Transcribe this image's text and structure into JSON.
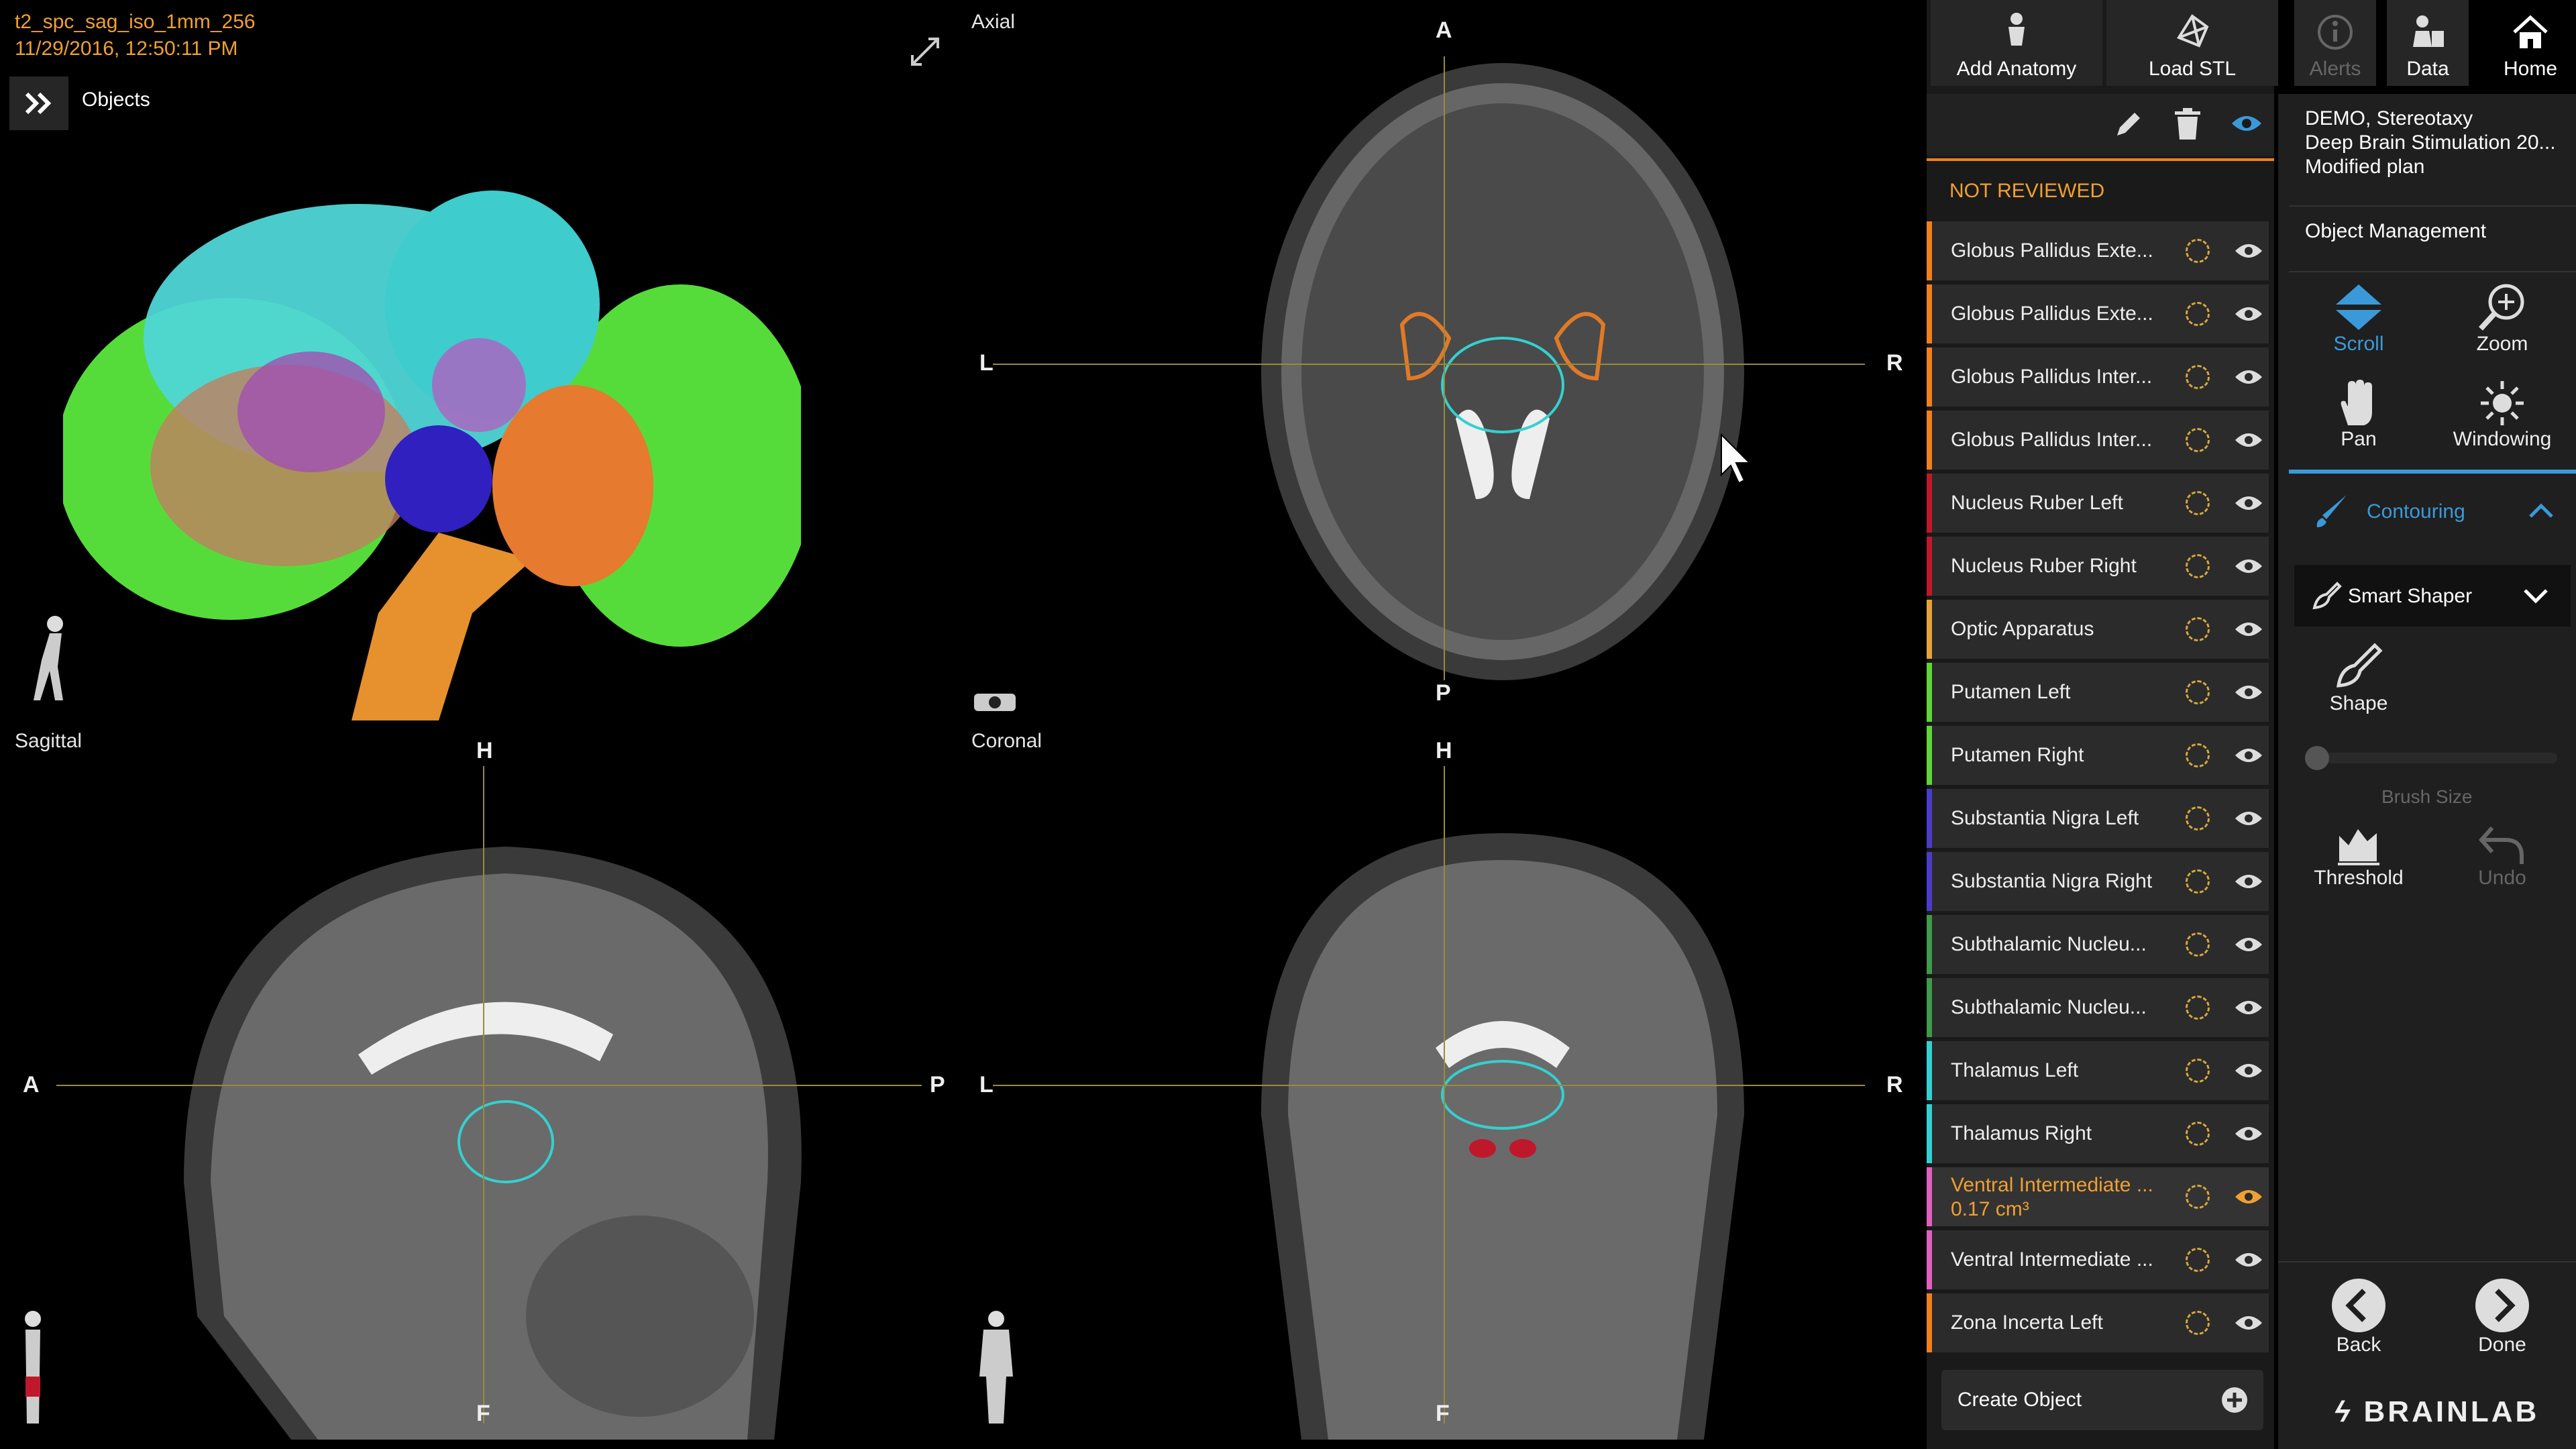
{
  "scan": {
    "series": "t2_spc_sag_iso_1mm_256",
    "datetime": "11/29/2016, 12:50:11 PM"
  },
  "view3d": {
    "objects_label": "Objects"
  },
  "views": {
    "axial": {
      "label": "Axial",
      "top": "A",
      "bottom": "P",
      "left": "L",
      "right": "R"
    },
    "sagittal": {
      "label": "Sagittal",
      "top": "H",
      "bottom": "F",
      "left": "A",
      "right": "P"
    },
    "coronal": {
      "label": "Coronal",
      "top": "H",
      "bottom": "F",
      "left": "L",
      "right": "R"
    }
  },
  "toolbar": {
    "add_anatomy": "Add Anatomy",
    "load_stl": "Load STL",
    "alerts": "Alerts",
    "data": "Data",
    "home": "Home"
  },
  "patient": {
    "name": "DEMO, Stereotaxy",
    "procedure": "Deep Brain Stimulation 20...",
    "plan": "Modified plan"
  },
  "object_management": "Object Management",
  "section_header": "NOT REVIEWED",
  "objects": [
    {
      "label": "Globus Pallidus Exte...",
      "color": "#f07f1e"
    },
    {
      "label": "Globus Pallidus Exte...",
      "color": "#f07f1e"
    },
    {
      "label": "Globus Pallidus Inter...",
      "color": "#f07f1e"
    },
    {
      "label": "Globus Pallidus Inter...",
      "color": "#f07f1e"
    },
    {
      "label": "Nucleus Ruber Left",
      "color": "#c0182b"
    },
    {
      "label": "Nucleus Ruber Right",
      "color": "#c0182b"
    },
    {
      "label": "Optic Apparatus",
      "color": "#e6a23a"
    },
    {
      "label": "Putamen Left",
      "color": "#5dd63a"
    },
    {
      "label": "Putamen Right",
      "color": "#5dd63a"
    },
    {
      "label": "Substantia Nigra Left",
      "color": "#4b3cc8"
    },
    {
      "label": "Substantia Nigra Right",
      "color": "#4b3cc8"
    },
    {
      "label": "Subthalamic Nucleu...",
      "color": "#3f9a4a"
    },
    {
      "label": "Subthalamic Nucleu...",
      "color": "#3f9a4a"
    },
    {
      "label": "Thalamus Left",
      "color": "#35d0d0"
    },
    {
      "label": "Thalamus Right",
      "color": "#35d0d0"
    },
    {
      "label": "Ventral Intermediate ...",
      "sub": "0.17 cm³",
      "color": "#e060c0",
      "selected": true
    },
    {
      "label": "Ventral Intermediate ...",
      "color": "#e060c0"
    },
    {
      "label": "Zona Incerta Left",
      "color": "#f07f1e"
    }
  ],
  "create_object": "Create Object",
  "tools": {
    "scroll": "Scroll",
    "zoom": "Zoom",
    "pan": "Pan",
    "windowing": "Windowing",
    "contouring": "Contouring",
    "smart_shaper": "Smart Shaper",
    "shape": "Shape",
    "brush_size": "Brush Size",
    "brush_value": 0,
    "threshold": "Threshold",
    "undo": "Undo"
  },
  "nav": {
    "back": "Back",
    "done": "Done"
  },
  "brand": "BRAINLAB",
  "colors": {
    "accent_orange": "#f0a030",
    "accent_blue": "#3a9ad9",
    "panel_bg": "#1c1c1c"
  }
}
